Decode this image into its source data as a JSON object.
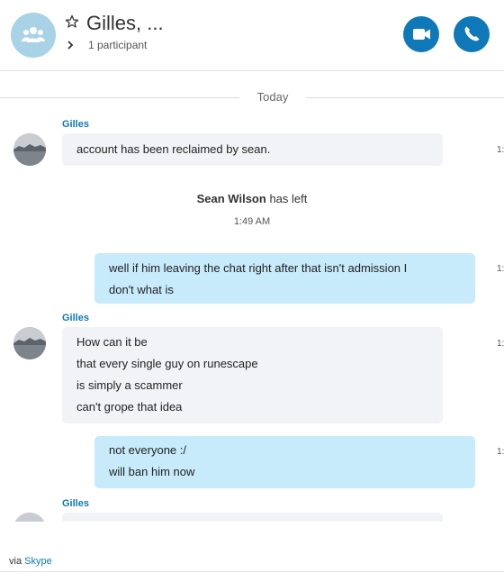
{
  "header": {
    "title": "Gilles, ...",
    "participants": "1 participant",
    "icons": {
      "group": "group-avatar-icon",
      "favorite": "star-icon",
      "expand": "chevron-right-icon",
      "video": "video-call-icon",
      "phone": "phone-call-icon"
    },
    "colors": {
      "accent": "#0f78b8",
      "avatar_bg": "#a8d3e6"
    }
  },
  "day_separator": "Today",
  "messages": [
    {
      "sender": "Gilles",
      "direction": "in",
      "lines": [
        "account has been reclaimed by sean."
      ],
      "time": "1:"
    },
    {
      "direction": "out",
      "lines": [
        "well if him leaving the chat right after that isn't admission I",
        "don't what is"
      ],
      "time": "1:"
    },
    {
      "sender": "Gilles",
      "direction": "in",
      "lines": [
        "How can it be",
        "that every single guy on runescape",
        "is simply a scammer",
        "can't grope that idea"
      ],
      "time": "1:"
    },
    {
      "direction": "out",
      "lines": [
        "not everyone :/",
        "will ban him now"
      ],
      "time": "1:"
    },
    {
      "sender": "Gilles",
      "direction": "in",
      "lines": []
    }
  ],
  "system_event": {
    "name": "Sean Wilson",
    "text": "has left",
    "time": "1:49 AM"
  },
  "footer": {
    "via": "via",
    "link": "Skype"
  },
  "colors": {
    "incoming_bubble": "#f2f3f6",
    "outgoing_bubble": "#c7ebfa",
    "sender_name": "#0f78b8"
  }
}
